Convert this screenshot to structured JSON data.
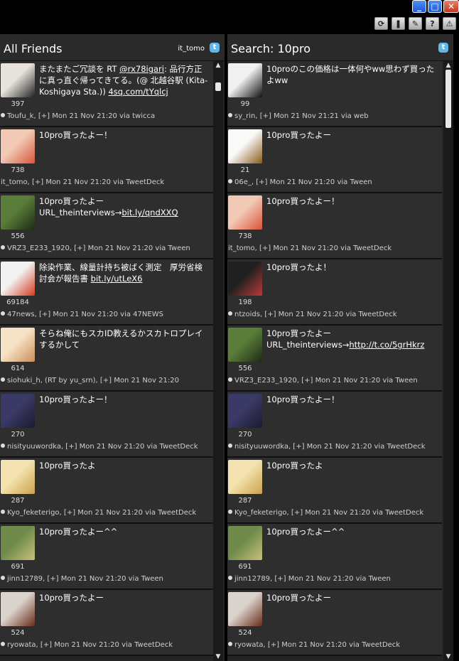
{
  "toolbar": {
    "icons": [
      "refresh-icon",
      "pause-icon",
      "settings-icon",
      "help-icon",
      "warning-icon"
    ],
    "glyphs": [
      "⟳",
      "❚",
      "✎",
      "?",
      "⚠"
    ]
  },
  "columns": [
    {
      "title": "All Friends",
      "user": "it_tomo",
      "tweets": [
        {
          "text": "またまたご冗談を RT ",
          "mention": "@rx78igari",
          "text2": ": 品行方正に真っ直ぐ帰ってきてる。(@ 北越谷駅 (Kita-Koshigaya Sta.)) ",
          "link": "4sq.com/tYqlcj",
          "count": "397",
          "meta": "Toufu_k, [+] Mon 21 Nov 21:20 via twicca",
          "avatar": "#e8e4dc",
          "accent": "#222"
        },
        {
          "text": "10pro買ったよー！",
          "count": "738",
          "meta": "it_tomo, [+] Mon 21 Nov 21:20 via TweetDeck",
          "avatar": "#f1c9b5",
          "accent": "#d8553c",
          "nodot": true
        },
        {
          "text": "10pro買ったよー URL_theinterviews→",
          "link": "bit.ly/qndXXQ",
          "count": "556",
          "meta": "VRZ3_E233_1920, [+] Mon 21 Nov 21:20 via Tween",
          "avatar": "#5a7d3a",
          "accent": "#1e2a14"
        },
        {
          "text": "除染作業、線量計持ち被ばく測定　厚労省検討会が報告書 ",
          "link": "bit.ly/utLeX6",
          "count": "69184",
          "meta": "47news, [+] Mon 21 Nov 21:20 via 47NEWS",
          "avatar": "#f2f2f2",
          "accent": "#d43b20"
        },
        {
          "text": "そらね俺にもスカID教えるかスカトロプレイするかして",
          "count": "614",
          "meta": "siohuki_h, (RT by yu_srn), [+] Mon 21 Nov 21:20",
          "avatar": "#f6e2c4",
          "accent": "#c98e5a"
        },
        {
          "text": "10pro買ったよー！",
          "count": "270",
          "meta": "nisityuuwordka, [+] Mon 21 Nov 21:20 via TweetDeck",
          "avatar": "#3b3a66",
          "accent": "#1a1a30"
        },
        {
          "text": "10pro買ったよ",
          "count": "287",
          "meta": "Kyo_feketerigo, [+] Mon 21 Nov 21:20 via TweetDeck",
          "avatar": "#f4e3b0",
          "accent": "#c9a34c"
        },
        {
          "text": "10pro買ったよー^^",
          "count": "691",
          "meta": "jinn12789, [+] Mon 21 Nov 21:20 via Tween",
          "avatar": "#6f8a4a",
          "accent": "#c9c07a"
        },
        {
          "text": "10pro買ったよー",
          "count": "524",
          "meta": "ryowata, [+] Mon 21 Nov 21:20 via TweetDeck",
          "avatar": "#d9d3cc",
          "accent": "#6a2a18"
        }
      ]
    },
    {
      "title": "Search: 10pro",
      "user": "",
      "tweets": [
        {
          "text": "10proのこの価格は一体何やww思わず買ったよww",
          "count": "99",
          "meta": "sy_rin, [+] Mon 21 Nov 21:21 via web",
          "avatar": "#f0f0f0",
          "accent": "#111"
        },
        {
          "text": "10pro買ったよー",
          "count": "21",
          "meta": "06e_, [+] Mon 21 Nov 21:20 via Tween",
          "avatar": "#fafafa",
          "accent": "#8a5a1c"
        },
        {
          "text": "10pro買ったよー！",
          "count": "738",
          "meta": "it_tomo, [+] Mon 21 Nov 21:20 via TweetDeck",
          "avatar": "#f1c9b5",
          "accent": "#d8553c",
          "nodot": true
        },
        {
          "text": "10pro買ったよ！",
          "count": "198",
          "meta": "ntzoids, [+] Mon 21 Nov 21:20 via TweetDeck",
          "avatar": "#202020",
          "accent": "#b83a3a"
        },
        {
          "text": "10pro買ったよー URL_theinterviews→",
          "link": "http://t.co/5grHkrz",
          "count": "556",
          "meta": "VRZ3_E233_1920, [+] Mon 21 Nov 21:20 via Tween",
          "avatar": "#5a7d3a",
          "accent": "#1e2a14"
        },
        {
          "text": "10pro買ったよー！",
          "count": "270",
          "meta": "nisityuuwordka, [+] Mon 21 Nov 21:20 via TweetDeck",
          "avatar": "#3b3a66",
          "accent": "#1a1a30"
        },
        {
          "text": "10pro買ったよ",
          "count": "287",
          "meta": "Kyo_feketerigo, [+] Mon 21 Nov 21:20 via TweetDeck",
          "avatar": "#f4e3b0",
          "accent": "#c9a34c"
        },
        {
          "text": "10pro買ったよー^^",
          "count": "691",
          "meta": "jinn12789, [+] Mon 21 Nov 21:20 via Tween",
          "avatar": "#6f8a4a",
          "accent": "#c9c07a"
        },
        {
          "text": "10pro買ったよー",
          "count": "524",
          "meta": "ryowata, [+] Mon 21 Nov 21:20 via TweetDeck",
          "avatar": "#d9d3cc",
          "accent": "#6a2a18"
        }
      ]
    }
  ]
}
